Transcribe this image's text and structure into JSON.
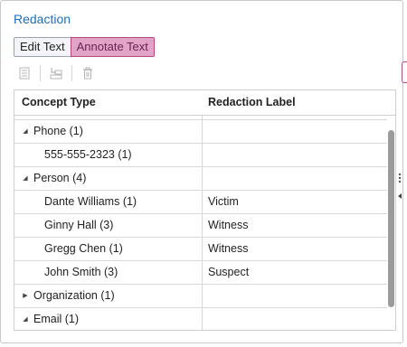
{
  "panel": {
    "title": "Redaction",
    "mode_tabs": [
      {
        "label": "Edit Text",
        "selected": false
      },
      {
        "label": "Annotate Text",
        "selected": true
      }
    ],
    "toolbar": {
      "icons": [
        "document-icon",
        "insert-row-icon",
        "trash-icon"
      ]
    }
  },
  "table": {
    "columns": [
      "Concept Type",
      "Redaction Label"
    ],
    "rows": [
      {
        "level": 0,
        "caret": "expanded",
        "concept": "Phone (1)",
        "label": ""
      },
      {
        "level": 1,
        "caret": "",
        "concept": "555-555-2323 (1)",
        "label": ""
      },
      {
        "level": 0,
        "caret": "expanded",
        "concept": "Person (4)",
        "label": ""
      },
      {
        "level": 1,
        "caret": "",
        "concept": "Dante Williams (1)",
        "label": "Victim"
      },
      {
        "level": 1,
        "caret": "",
        "concept": "Ginny Hall (3)",
        "label": "Witness"
      },
      {
        "level": 1,
        "caret": "",
        "concept": "Gregg Chen (1)",
        "label": "Witness"
      },
      {
        "level": 1,
        "caret": "",
        "concept": "John Smith (3)",
        "label": "Suspect"
      },
      {
        "level": 0,
        "caret": "collapsed",
        "concept": "Organization (1)",
        "label": ""
      },
      {
        "level": 0,
        "caret": "expanded",
        "concept": "Email (1)",
        "label": ""
      }
    ]
  },
  "colors": {
    "title": "#1f6eb6",
    "annotate_bg": "#e2a3c8",
    "annotate_border": "#b1497e",
    "scrollbar": "#9b9b9b"
  }
}
